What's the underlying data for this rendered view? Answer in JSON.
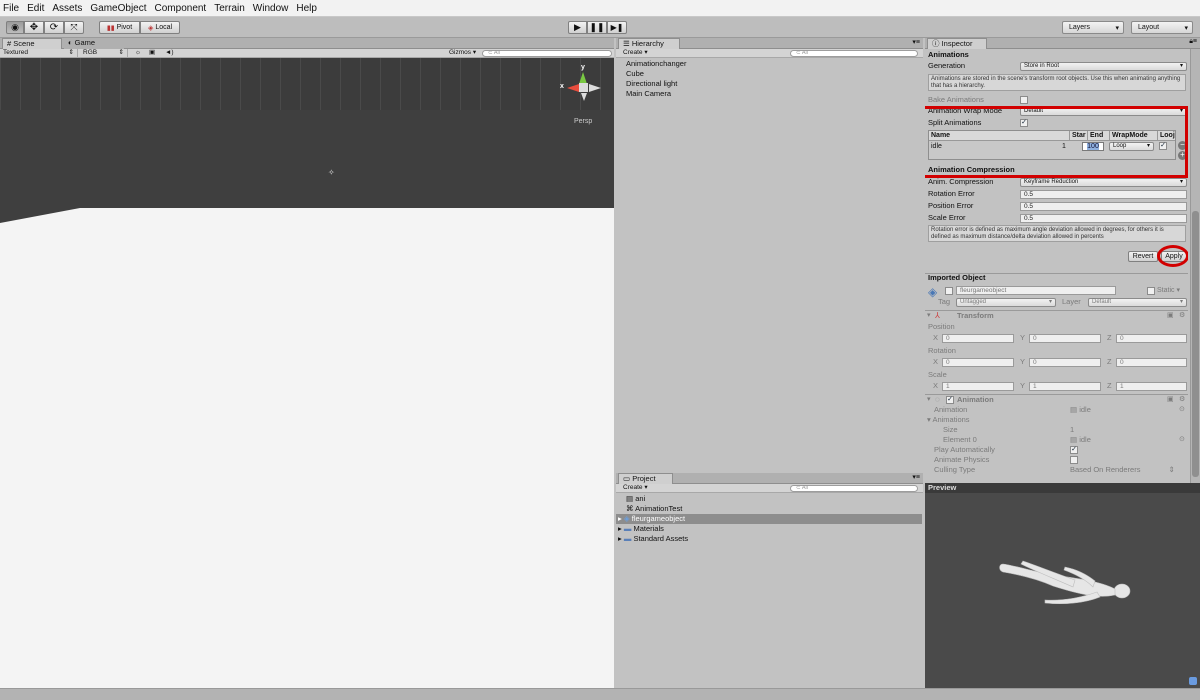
{
  "menu": [
    "File",
    "Edit",
    "Assets",
    "GameObject",
    "Component",
    "Terrain",
    "Window",
    "Help"
  ],
  "toolbar": {
    "pivot": "Pivot",
    "local": "Local",
    "layers": "Layers",
    "layout": "Layout"
  },
  "scene": {
    "tab_scene": "Scene",
    "tab_game": "Game",
    "textured": "Textured",
    "rgb": "RGB",
    "gizmos": "Gizmos",
    "search_placeholder": "All",
    "persp": "Persp",
    "axis_y": "y",
    "axis_x": "x"
  },
  "hierarchy": {
    "title": "Hierarchy",
    "create": "Create",
    "search_placeholder": "All",
    "items": [
      "Animationchanger",
      "Cube",
      "Directional light",
      "Main Camera"
    ]
  },
  "project": {
    "title": "Project",
    "create": "Create",
    "search_placeholder": "All",
    "items": [
      "ani",
      "AnimationTest",
      "fleurgameobject",
      "Materials",
      "Standard Assets"
    ]
  },
  "inspector": {
    "title": "Inspector",
    "animations_header": "Animations",
    "generation_label": "Generation",
    "generation_value": "Store in Root",
    "generation_help": "Animations are stored in the scene's transform root objects. Use this when animating anything that has a hierarchy.",
    "bake_label": "Bake Animations",
    "wrap_label": "Animation Wrap Mode",
    "wrap_value": "Default",
    "split_label": "Split Animations",
    "table_headers": {
      "name": "Name",
      "start": "Star",
      "end": "End",
      "wrap": "WrapMode",
      "loop": "Looj"
    },
    "clip": {
      "name": "idle",
      "start": "1",
      "end": "100",
      "wrap": "Loop"
    },
    "compression_header": "Animation Compression",
    "anim_comp_label": "Anim. Compression",
    "anim_comp_value": "Keyframe Reduction",
    "rot_err_label": "Rotation Error",
    "rot_err_value": "0.5",
    "pos_err_label": "Position Error",
    "pos_err_value": "0.5",
    "scale_err_label": "Scale Error",
    "scale_err_value": "0.5",
    "error_help": "Rotation error is defined as maximum angle deviation allowed in degrees, for others it is defined as maximum distance/delta deviation allowed in percents",
    "revert": "Revert",
    "apply": "Apply",
    "imported_header": "Imported Object",
    "object_name": "fleurgameobject",
    "static": "Static",
    "tag_label": "Tag",
    "tag_value": "Untagged",
    "layer_label": "Layer",
    "layer_value": "Default",
    "transform": "Transform",
    "position": "Position",
    "rotation": "Rotation",
    "scale": "Scale",
    "x": "X",
    "y": "Y",
    "z": "Z",
    "pos": {
      "x": "0",
      "y": "0",
      "z": "0"
    },
    "rot": {
      "x": "0",
      "y": "0",
      "z": "0"
    },
    "scl": {
      "x": "1",
      "y": "1",
      "z": "1"
    },
    "animation_comp": "Animation",
    "anim_label": "Animation",
    "anim_value": "idle",
    "anims_label": "Animations",
    "size_label": "Size",
    "size_value": "1",
    "element0_label": "Element 0",
    "element0_value": "idle",
    "play_auto": "Play Automatically",
    "anim_physics": "Animate Physics",
    "culling_label": "Culling Type",
    "culling_value": "Based On Renderers"
  },
  "preview": {
    "title": "Preview"
  },
  "colors": {
    "highlight": "#d20000",
    "selection": "#3e6fb0"
  }
}
